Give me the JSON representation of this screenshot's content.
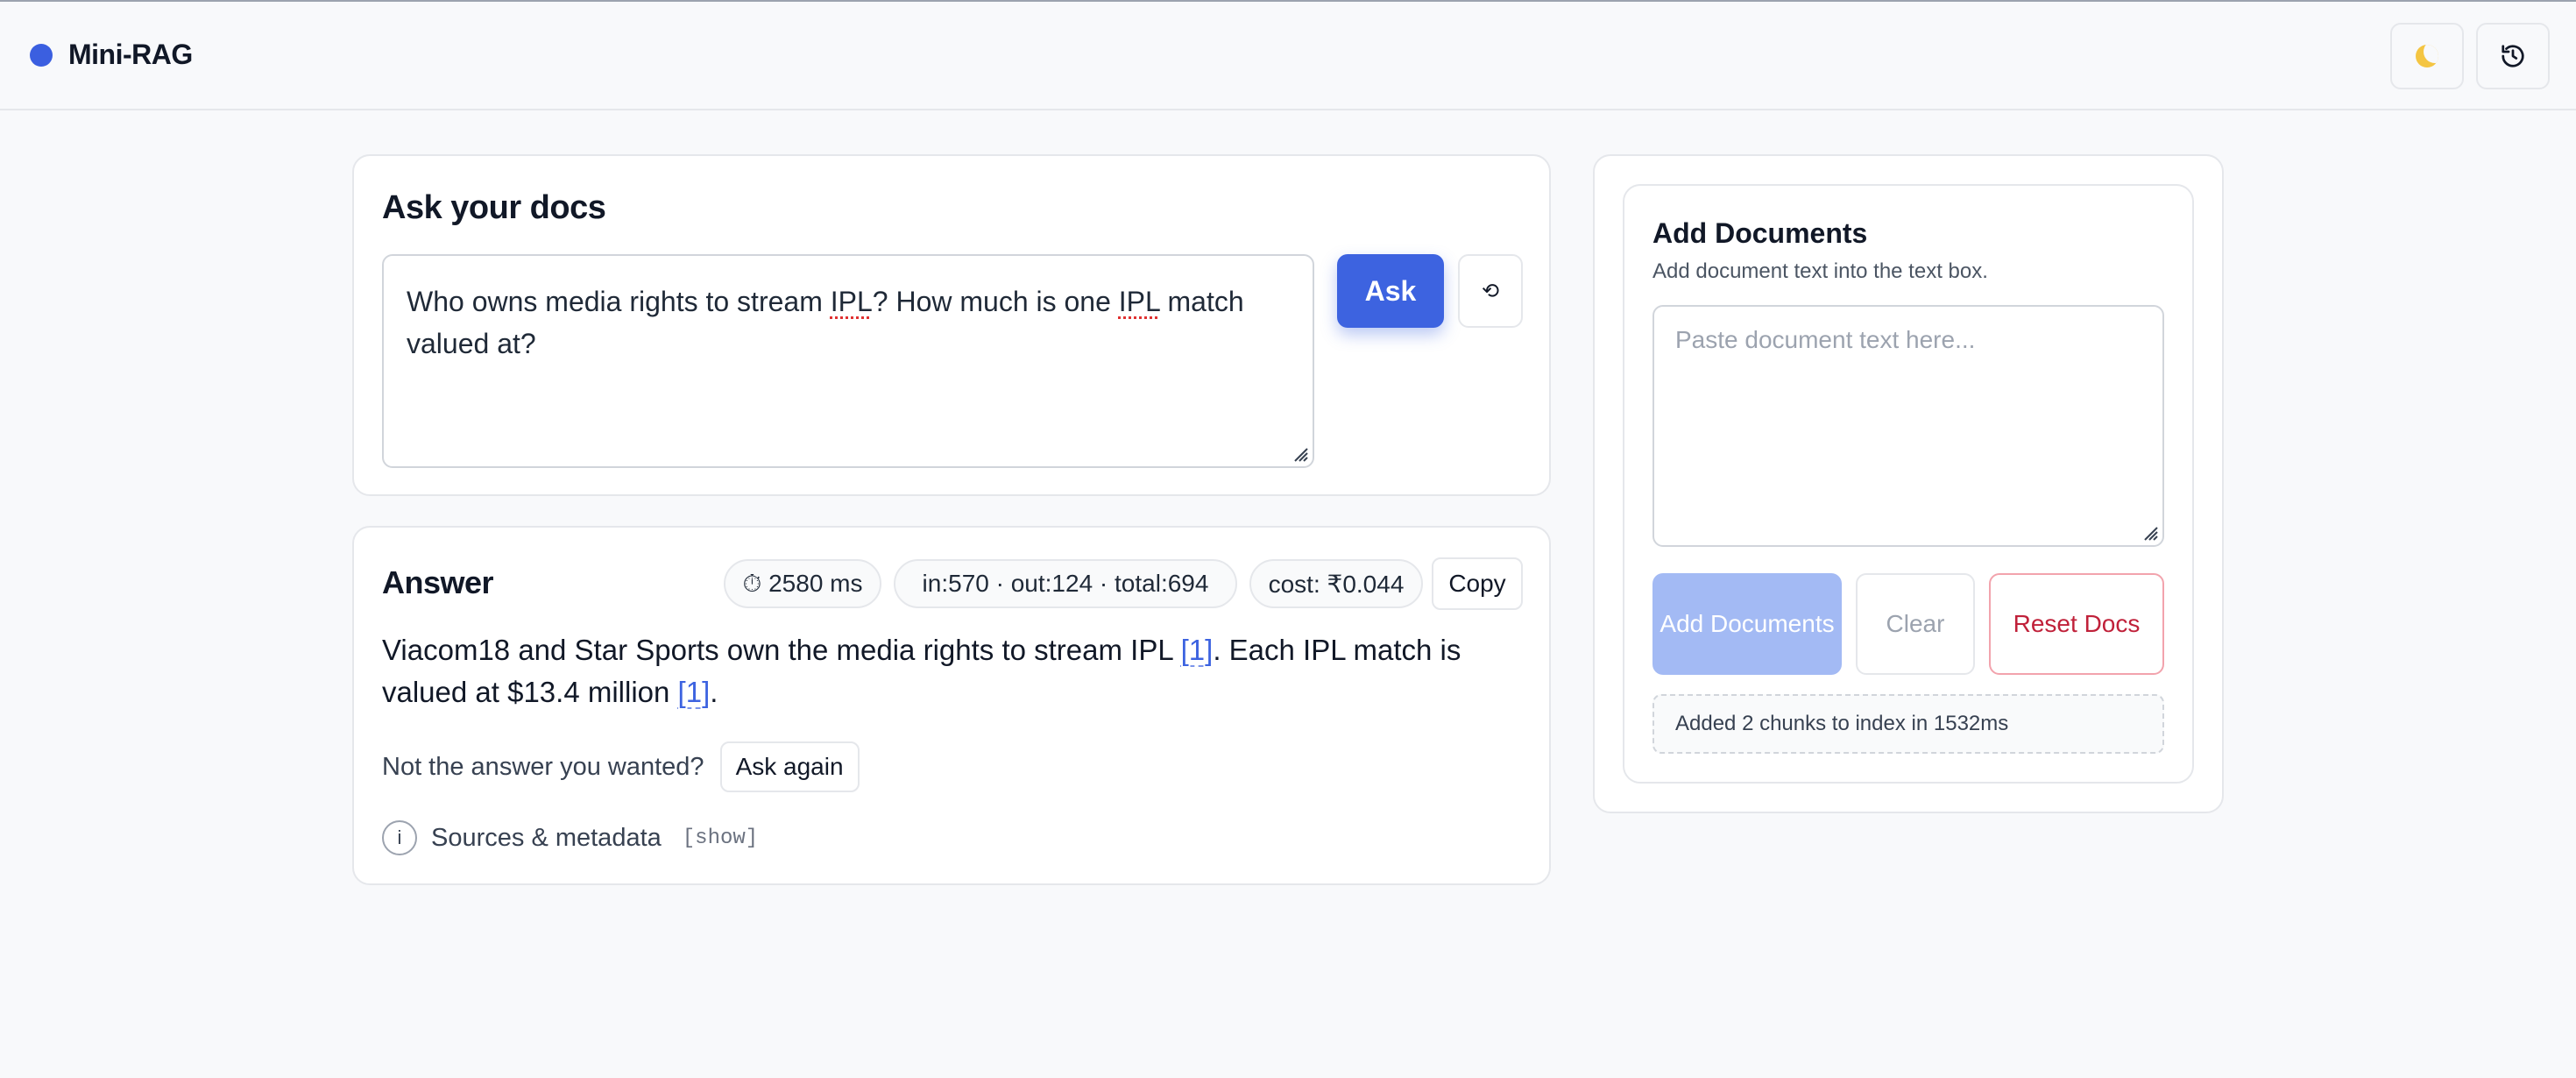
{
  "app": {
    "name": "Mini-RAG"
  },
  "header": {
    "theme_icon": "moon-icon",
    "reset_icon": "history-reset-icon"
  },
  "ask": {
    "title": "Ask your docs",
    "query_line1_pre": "Who owns media rights to stream ",
    "query_ipl": "IPL",
    "query_line1_mid": "? How much is one ",
    "query_line1_post": " match valued at?",
    "ask_label": "Ask",
    "history_icon": "⟲"
  },
  "answer": {
    "title": "Answer",
    "latency": "⏱ 2580 ms",
    "tokens": "in:570 · out:124 · total:694",
    "cost": "cost: ₹0.044",
    "copy_label": "Copy",
    "text_part1": "Viacom18 and Star Sports own the media rights to stream IPL ",
    "citation1": "[1]",
    "text_part2": ". Each IPL match is valued at $13.4 million ",
    "citation2": "[1]",
    "text_part3": ".",
    "not_wanted": "Not the answer you wanted?",
    "ask_again": "Ask again",
    "info_glyph": "i",
    "sources_label": "Sources & metadata",
    "show_label": "[show]"
  },
  "docs": {
    "title": "Add Documents",
    "subtitle": "Add document text into the text box.",
    "placeholder": "Paste document text here...",
    "add_label": "Add Documents",
    "clear_label": "Clear",
    "reset_label": "Reset Docs",
    "status": "Added 2 chunks to index in 1532ms"
  },
  "colors": {
    "accent": "#3d63e0",
    "danger": "#c0213a",
    "background": "#f8f9fb"
  }
}
